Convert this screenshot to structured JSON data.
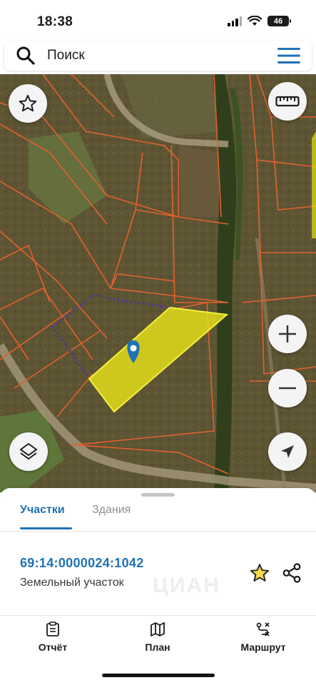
{
  "status_bar": {
    "time": "18:38",
    "battery": "46"
  },
  "header": {
    "search_label": "Поиск"
  },
  "map": {
    "selected_color": "#e6e21a",
    "boundary_color": "#e2612e",
    "dotted_outline_color": "#4a2fbe"
  },
  "sheet": {
    "tabs": [
      {
        "label": "Участки",
        "active": true
      },
      {
        "label": "Здания",
        "active": false
      }
    ],
    "parcel": {
      "cadastral_number": "69:14:0000024:1042",
      "type": "Земельный участок"
    },
    "watermark": "ЦИАН"
  },
  "bottom_nav": [
    {
      "label": "Отчёт",
      "icon": "report-icon"
    },
    {
      "label": "План",
      "icon": "map-plan-icon"
    },
    {
      "label": "Маршрут",
      "icon": "route-icon"
    }
  ],
  "colors": {
    "accent": "#1f73b7"
  }
}
